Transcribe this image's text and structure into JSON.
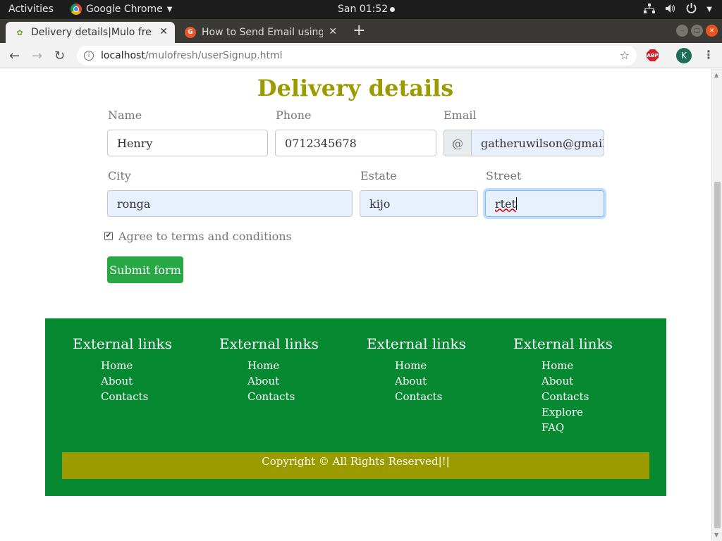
{
  "topbar": {
    "activities": "Activities",
    "app_name": "Google Chrome",
    "clock": "San 01:52"
  },
  "tabs": [
    {
      "title": "Delivery details|Mulo fresh",
      "icon": "leaf-favicon-icon"
    },
    {
      "title": "How to Send Email using",
      "icon": "generic-favicon-icon"
    }
  ],
  "address_bar": {
    "host": "localhost",
    "path": "/mulofresh/userSignup.html",
    "profile_initial": "K",
    "extension_label": "ABP"
  },
  "form": {
    "title": "Delivery details",
    "name_label": "Name",
    "name_value": "Henry",
    "phone_label": "Phone",
    "phone_value": "0712345678",
    "email_label": "Email",
    "email_prefix": "@",
    "email_value": "gatheruwilson@gmail.com",
    "city_label": "City",
    "city_value": "ronga",
    "estate_label": "Estate",
    "estate_value": "kijo",
    "street_label": "Street",
    "street_value": "rtet",
    "terms_label": "Agree to terms and conditions",
    "terms_checked": true,
    "submit_label": "Submit form"
  },
  "footer": {
    "columns": [
      {
        "heading": "External links",
        "links": [
          "Home",
          "About",
          "Contacts"
        ]
      },
      {
        "heading": "External links",
        "links": [
          "Home",
          "About",
          "Contacts"
        ]
      },
      {
        "heading": "External links",
        "links": [
          "Home",
          "About",
          "Contacts"
        ]
      },
      {
        "heading": "External links",
        "links": [
          "Home",
          "About",
          "Contacts",
          "Explore",
          "FAQ"
        ]
      }
    ],
    "copyright": "Copyright © All Rights Reserved|!|"
  },
  "colors": {
    "title_olive": "#9b9b00",
    "footer_green": "#068930",
    "submit_green": "#28a745",
    "copyright_bar": "#9b9b00"
  }
}
